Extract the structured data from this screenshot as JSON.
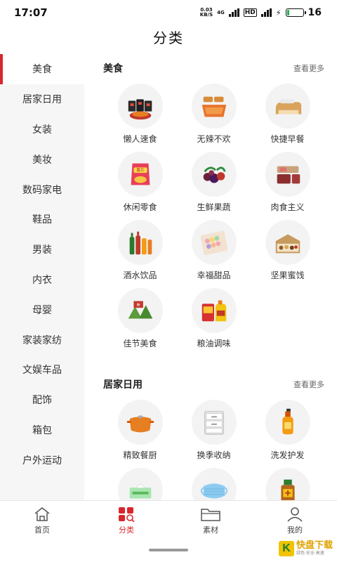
{
  "status": {
    "time": "17:07",
    "net_speed_top": "0.03",
    "net_speed_bottom": "KB/S",
    "net_type": "4G",
    "hd": "HD",
    "battery": "16",
    "battery_level": 0.16
  },
  "header": {
    "title": "分类"
  },
  "sidebar": {
    "items": [
      {
        "label": "美食"
      },
      {
        "label": "居家日用"
      },
      {
        "label": "女装"
      },
      {
        "label": "美妆"
      },
      {
        "label": "数码家电"
      },
      {
        "label": "鞋品"
      },
      {
        "label": "男装"
      },
      {
        "label": "内衣"
      },
      {
        "label": "母婴"
      },
      {
        "label": "家装家纺"
      },
      {
        "label": "文娱车品"
      },
      {
        "label": "配饰"
      },
      {
        "label": "箱包"
      },
      {
        "label": "户外运动"
      }
    ],
    "active_index": 0
  },
  "sections": [
    {
      "title": "美食",
      "more": "查看更多",
      "items": [
        {
          "label": "懒人速食",
          "icon": "instant-noodles-icon"
        },
        {
          "label": "无辣不欢",
          "icon": "spicy-snacks-icon"
        },
        {
          "label": "快捷早餐",
          "icon": "bread-icon"
        },
        {
          "label": "休闲零食",
          "icon": "chips-icon"
        },
        {
          "label": "生鲜果蔬",
          "icon": "fruit-icon"
        },
        {
          "label": "肉食主义",
          "icon": "meat-icon"
        },
        {
          "label": "酒水饮品",
          "icon": "drinks-icon"
        },
        {
          "label": "幸福甜品",
          "icon": "macaron-icon"
        },
        {
          "label": "坚果蜜饯",
          "icon": "nuts-icon"
        },
        {
          "label": "佳节美食",
          "icon": "zongzi-icon"
        },
        {
          "label": "粮油调味",
          "icon": "oil-icon"
        }
      ]
    },
    {
      "title": "居家日用",
      "more": "查看更多",
      "items": [
        {
          "label": "精致餐厨",
          "icon": "pot-icon"
        },
        {
          "label": "换季收纳",
          "icon": "storage-drawer-icon"
        },
        {
          "label": "洗发护发",
          "icon": "shampoo-icon"
        },
        {
          "label": "",
          "icon": "tissue-icon"
        },
        {
          "label": "",
          "icon": "mask-icon"
        },
        {
          "label": "",
          "icon": "disinfectant-icon"
        }
      ]
    }
  ],
  "tabs": [
    {
      "label": "首页",
      "icon": "home-icon"
    },
    {
      "label": "分类",
      "icon": "category-icon"
    },
    {
      "label": "素材",
      "icon": "folder-icon"
    },
    {
      "label": "我的",
      "icon": "user-icon"
    }
  ],
  "active_tab": 1,
  "watermark": {
    "name": "快盘下载",
    "sub": "绿色·安全·高速"
  },
  "colors": {
    "accent": "#d9262c",
    "sidebar_bg": "#f6f6f6"
  }
}
